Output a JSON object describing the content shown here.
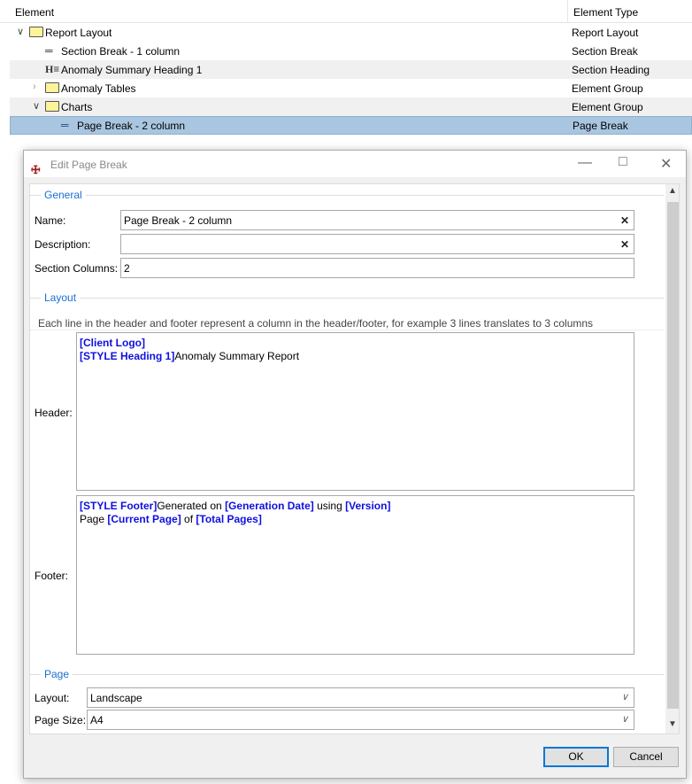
{
  "tree": {
    "columns": [
      "Element",
      "Element Type"
    ],
    "rows": [
      {
        "label": "Report Layout",
        "type": "Report Layout",
        "icon": "folder-icon",
        "expander": "expanded"
      },
      {
        "label": "Section Break - 1 column",
        "type": "Section Break",
        "icon": "section-break-icon"
      },
      {
        "label": "Anomaly Summary Heading 1",
        "type": "Section Heading",
        "icon": "heading-icon"
      },
      {
        "label": "Anomaly Tables",
        "type": "Element Group",
        "icon": "folder-icon",
        "expander": "collapsed"
      },
      {
        "label": "Charts",
        "type": "Element Group",
        "icon": "folder-icon",
        "expander": "expanded"
      },
      {
        "label": "Page Break - 2 column",
        "type": "Page Break",
        "icon": "page-break-icon",
        "selected": true
      }
    ]
  },
  "dialog": {
    "title": "Edit Page Break",
    "general": {
      "legend": "General",
      "name_label": "Name:",
      "name_value": "Page Break - 2 column",
      "desc_label": "Description:",
      "desc_value": "",
      "cols_label": "Section Columns:",
      "cols_value": "2"
    },
    "layout": {
      "legend": "Layout",
      "hint": "Each line in the header and footer represent a column in the header/footer, for example 3 lines translates to 3 columns",
      "header_label": "Header:",
      "footer_label": "Footer:",
      "header_lines": [
        [
          {
            "t": "[Client Logo]",
            "tok": true
          }
        ],
        [
          {
            "t": "[STYLE Heading 1]",
            "tok": true
          },
          {
            "t": "Anomaly Summary Report"
          }
        ]
      ],
      "footer_lines": [
        [
          {
            "t": "[STYLE Footer]",
            "tok": true
          },
          {
            "t": "Generated on "
          },
          {
            "t": "[Generation Date]",
            "tok": true
          },
          {
            "t": " using "
          },
          {
            "t": "[Version]",
            "tok": true
          }
        ],
        [
          {
            "t": "Page "
          },
          {
            "t": "[Current Page]",
            "tok": true
          },
          {
            "t": " of "
          },
          {
            "t": "[Total Pages]",
            "tok": true
          }
        ]
      ]
    },
    "page": {
      "legend": "Page",
      "layout_label": "Layout:",
      "layout_value": "Landscape",
      "size_label": "Page Size:",
      "size_value": "A4"
    },
    "ok": "OK",
    "cancel": "Cancel"
  },
  "colors": {
    "accent": "#1a6fd1",
    "token": "#1010e0",
    "selection": "#a9c6e0"
  }
}
